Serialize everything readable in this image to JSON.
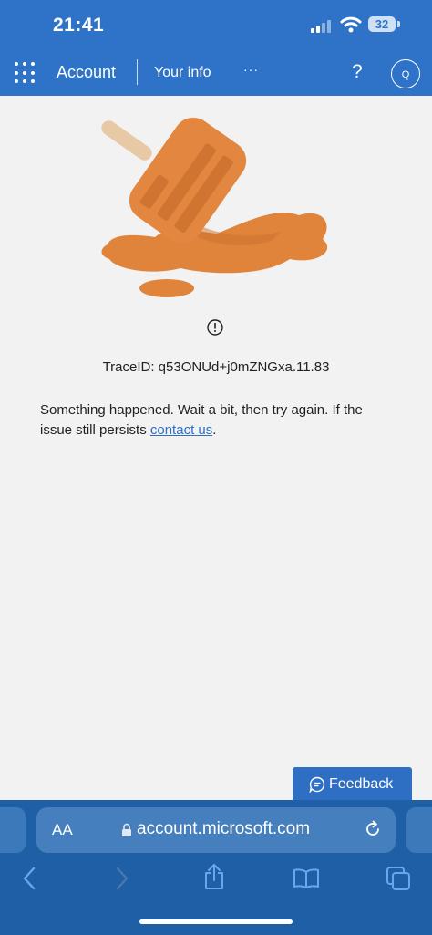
{
  "status_bar": {
    "time": "21:41",
    "battery": "32"
  },
  "app_bar": {
    "title": "Account",
    "nav_item": "Your info",
    "more": "···",
    "help": "?",
    "avatar_initial": "Q"
  },
  "error": {
    "trace_id": "TraceID: q53ONUd+j0mZNGxa.11.83",
    "message_text": "Something happened. Wait a bit, then try again. If the issue still persists ",
    "contact_link": "contact us",
    "message_end": "."
  },
  "feedback_button": {
    "label": "Feedback"
  },
  "browser": {
    "text_size_label": "AA",
    "url": "account.microsoft.com"
  },
  "icons": [
    "waffle-icon",
    "help-icon",
    "avatar",
    "melted-popsicle-illustration",
    "info-icon",
    "feedback-icon",
    "lock-icon",
    "reload-icon",
    "back-icon",
    "forward-icon",
    "share-icon",
    "bookmarks-icon",
    "tabs-icon"
  ],
  "colors": {
    "brand_blue": "#2f73c8",
    "popsicle_orange": "#e0843c",
    "browser_blue": "#1e5fa6"
  }
}
